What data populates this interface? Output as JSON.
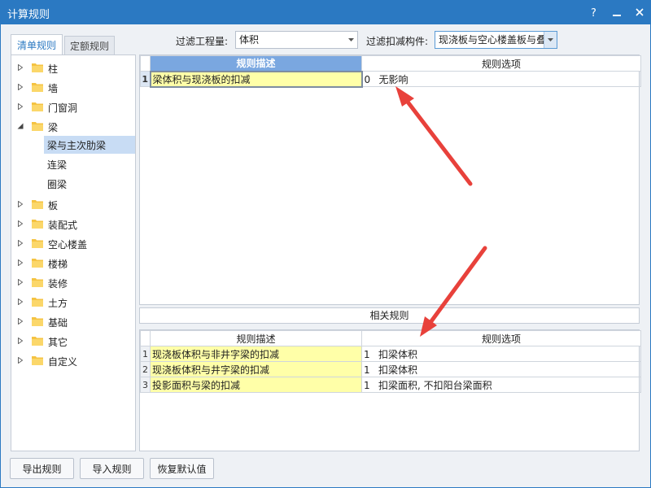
{
  "window": {
    "title": "计算规则"
  },
  "tabs": [
    {
      "label": "清单规则",
      "active": true
    },
    {
      "label": "定额规则",
      "active": false
    }
  ],
  "filters": {
    "quantity_label": "过滤工程量:",
    "quantity_value": "体积",
    "component_label": "过滤扣减构件:",
    "component_value": "现浇板与空心楼盖板与叠"
  },
  "tree": {
    "items": [
      {
        "label": "柱",
        "expanded": false
      },
      {
        "label": "墙",
        "expanded": false
      },
      {
        "label": "门窗洞",
        "expanded": false
      },
      {
        "label": "梁",
        "expanded": true,
        "children": [
          {
            "label": "梁与主次肋梁",
            "selected": true
          },
          {
            "label": "连梁",
            "selected": false
          },
          {
            "label": "圈梁",
            "selected": false
          }
        ]
      },
      {
        "label": "板",
        "expanded": false
      },
      {
        "label": "装配式",
        "expanded": false
      },
      {
        "label": "空心楼盖",
        "expanded": false
      },
      {
        "label": "楼梯",
        "expanded": false
      },
      {
        "label": "装修",
        "expanded": false
      },
      {
        "label": "土方",
        "expanded": false
      },
      {
        "label": "基础",
        "expanded": false
      },
      {
        "label": "其它",
        "expanded": false
      },
      {
        "label": "自定义",
        "expanded": false
      }
    ]
  },
  "main_grid": {
    "headers": [
      "规则描述",
      "规则选项"
    ],
    "rows": [
      {
        "index": "1",
        "description": "梁体积与现浇板的扣减",
        "option_code": "0",
        "option_text": "无影响"
      }
    ]
  },
  "related": {
    "title": "相关规则",
    "headers": [
      "规则描述",
      "规则选项"
    ],
    "rows": [
      {
        "index": "1",
        "description": "现浇板体积与非井字梁的扣减",
        "option_code": "1",
        "option_text": "扣梁体积"
      },
      {
        "index": "2",
        "description": "现浇板体积与井字梁的扣减",
        "option_code": "1",
        "option_text": "扣梁体积"
      },
      {
        "index": "3",
        "description": "投影面积与梁的扣减",
        "option_code": "1",
        "option_text": "扣梁面积, 不扣阳台梁面积"
      }
    ]
  },
  "buttons": {
    "export": "导出规则",
    "import": "导入规则",
    "restore": "恢复默认值"
  },
  "colors": {
    "titlebar": "#2b79c2",
    "highlight_yellow": "#ffffa8",
    "selected_tree": "#c8dcf4",
    "annotation_arrow": "#e8413b"
  }
}
